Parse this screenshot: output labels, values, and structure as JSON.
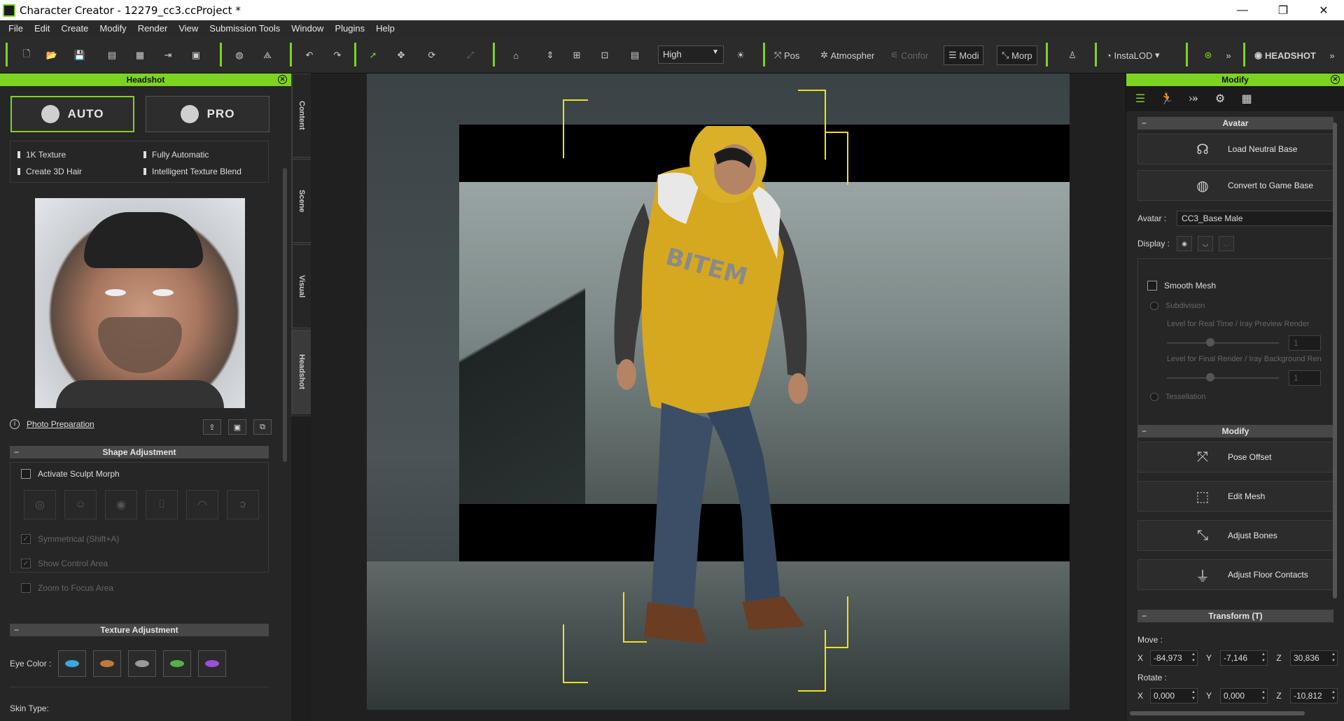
{
  "window": {
    "title": "Character Creator - 12279_cc3.ccProject *",
    "minimize": "—",
    "maximize": "❐",
    "close": "✕"
  },
  "menu": [
    "File",
    "Edit",
    "Create",
    "Modify",
    "Render",
    "View",
    "Submission Tools",
    "Window",
    "Plugins",
    "Help"
  ],
  "toolbar": {
    "quality": "High",
    "pos_label": "Pos",
    "atmosphere_label": "Atmospher",
    "conform_label": "Confor",
    "modify_label": "Modi",
    "morph_label": "Morp",
    "instalod_label": "InstaLOD",
    "headshot_label": "HEADSHOT",
    "more": "»"
  },
  "headshot_panel": {
    "title": "Headshot",
    "auto_label": "AUTO",
    "pro_label": "PRO",
    "features": [
      "1K Texture",
      "Fully Automatic",
      "Create 3D Hair",
      "Intelligent Texture Blend"
    ],
    "photo_prep": "Photo Preparation",
    "shape_section": "Shape Adjustment",
    "activate_sculpt": "Activate Sculpt Morph",
    "symmetrical": "Symmetrical (Shift+A)",
    "show_control": "Show Control Area",
    "zoom_focus": "Zoom to Focus Area",
    "texture_section": "Texture Adjustment",
    "eye_color_label": "Eye Color :",
    "eye_colors": [
      "#3ba6e0",
      "#c07a3c",
      "#9a9a9a",
      "#55b04a",
      "#9a50d8"
    ],
    "skin_type_label": "Skin Type:"
  },
  "side_tabs": [
    "Content",
    "Scene",
    "Visual",
    "Headshot"
  ],
  "modify_panel": {
    "title": "Modify",
    "avatar_section": "Avatar",
    "load_neutral": "Load Neutral Base",
    "convert_game": "Convert to Game Base",
    "avatar_label": "Avatar :",
    "avatar_value": "CC3_Base Male",
    "display_label": "Display :",
    "smooth_mesh": "Smooth Mesh",
    "subdivision": "Subdivision",
    "level_realtime": "Level for Real Time / Iray Preview Render",
    "level_final": "Level for Final Render / Iray Background Ren",
    "level_value_1": "1",
    "level_value_2": "1",
    "tessellation": "Tessellation",
    "modify_section": "Modify",
    "pose_offset": "Pose Offset",
    "edit_mesh": "Edit Mesh",
    "adjust_bones": "Adjust Bones",
    "adjust_floor": "Adjust Floor Contacts",
    "transform_section": "Transform  (T)",
    "move_label": "Move :",
    "rotate_label": "Rotate :",
    "move": {
      "x": "-84,973",
      "y": "-7,146",
      "z": "30,836"
    },
    "rotate": {
      "x": "0,000",
      "y": "0,000",
      "z": "-10,812"
    },
    "x": "X",
    "y": "Y",
    "z": "Z"
  },
  "accent_color": "#7dd321"
}
